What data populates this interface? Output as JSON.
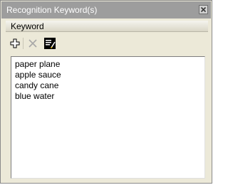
{
  "window": {
    "title": "Recognition Keyword(s)"
  },
  "section": {
    "label": "Keyword"
  },
  "toolbar": {
    "buttons": [
      {
        "icon": "plus-icon",
        "enabled": true
      },
      {
        "icon": "delete-icon",
        "enabled": false
      },
      {
        "icon": "edit-icon",
        "enabled": true
      }
    ]
  },
  "keywords": [
    "paper plane",
    "apple sauce",
    "candy cane",
    "blue water"
  ],
  "colors": {
    "titlebar": "#9d9d9d",
    "panel": "#ece9d8"
  }
}
